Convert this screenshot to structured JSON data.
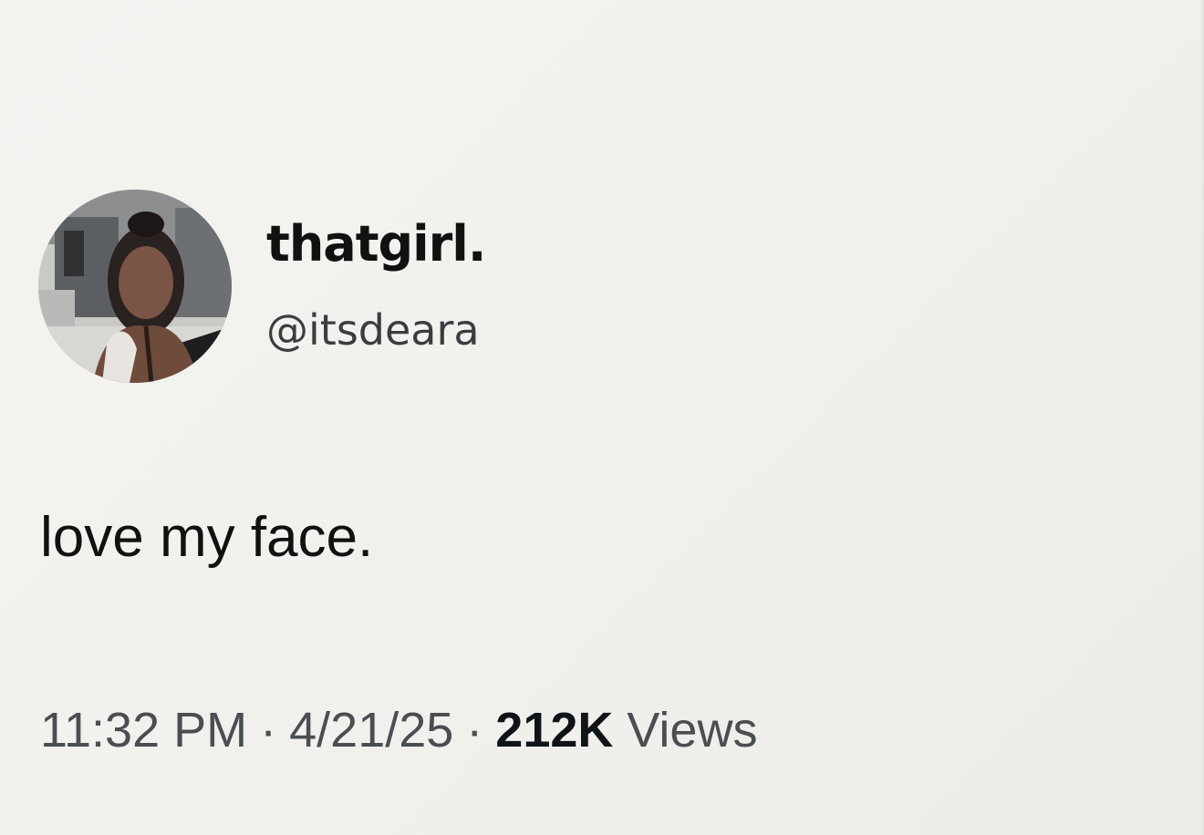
{
  "tweet": {
    "author": {
      "display_name": "thatgirl.",
      "handle": "@itsdeara",
      "avatar": "profile-photo"
    },
    "text": "love my face.",
    "meta": {
      "time": "11:32 PM",
      "separator": "·",
      "date": "4/21/25",
      "views_count": "212K",
      "views_label": "Views"
    }
  },
  "colors": {
    "background": "#f2f1ee",
    "text_primary": "#111111",
    "text_secondary": "#4a4e52"
  }
}
